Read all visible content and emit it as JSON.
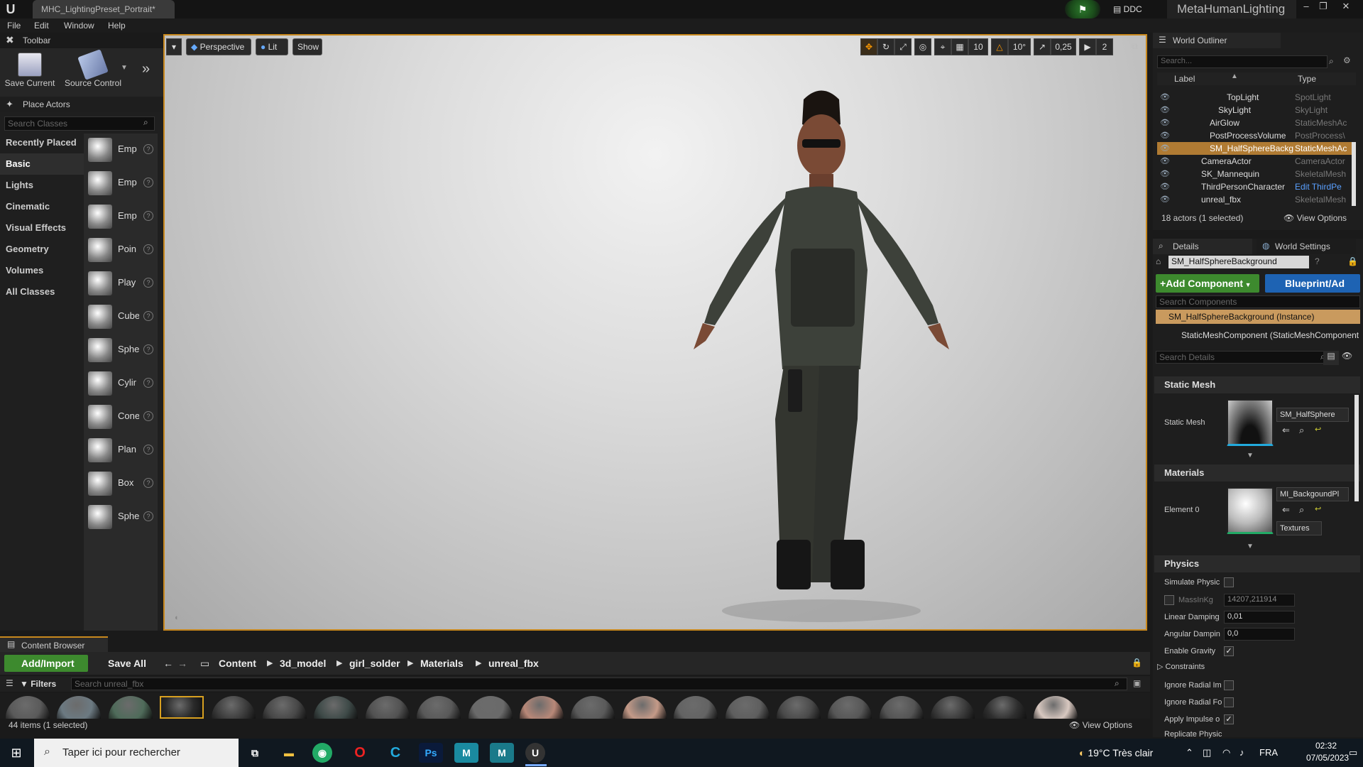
{
  "window": {
    "doc_tab": "MHC_LightingPreset_Portrait*",
    "ddc_label": "DDC",
    "project_name": "MetaHumanLighting",
    "controls": [
      "‒",
      "❐",
      "✕"
    ]
  },
  "menu": [
    "File",
    "Edit",
    "Window",
    "Help"
  ],
  "toolbar_panel": {
    "title": "Toolbar",
    "save_current": "Save Current",
    "source_control": "Source Control",
    "more": "»"
  },
  "place_actors": {
    "title": "Place Actors",
    "search_placeholder": "Search Classes",
    "categories": [
      "Recently Placed",
      "Basic",
      "Lights",
      "Cinematic",
      "Visual Effects",
      "Geometry",
      "Volumes",
      "All Classes"
    ],
    "active_category": "Basic",
    "actors": [
      "Emp",
      "Emp",
      "Emp",
      "Poin",
      "Play",
      "Cube",
      "Sphe",
      "Cylir",
      "Cone",
      "Plan",
      "Box",
      "Sphe"
    ]
  },
  "viewport": {
    "perspective": "Perspective",
    "lit": "Lit",
    "show": "Show",
    "grid_snap": "10",
    "rot_snap": "10°",
    "scale_snap": "0,25",
    "camera_speed": "2"
  },
  "outliner": {
    "title": "World Outliner",
    "search_placeholder": "Search...",
    "col_label": "Label",
    "col_type": "Type",
    "rows": [
      {
        "label": "TopLight",
        "type": "SpotLight",
        "indent": 3,
        "selected": false
      },
      {
        "label": "SkyLight",
        "type": "SkyLight",
        "indent": 2,
        "selected": false
      },
      {
        "label": "AirGlow",
        "type": "StaticMeshAc",
        "indent": 1,
        "selected": false
      },
      {
        "label": "PostProcessVolume",
        "type": "PostProcess\\",
        "indent": 1,
        "selected": false
      },
      {
        "label": "SM_HalfSphereBackg",
        "type": "StaticMeshAc",
        "indent": 1,
        "selected": true
      },
      {
        "label": "CameraActor",
        "type": "CameraActor",
        "indent": 0,
        "selected": false
      },
      {
        "label": "SK_Mannequin",
        "type": "SkeletalMesh",
        "indent": 0,
        "selected": false
      },
      {
        "label": "ThirdPersonCharacter",
        "type": "Edit ThirdPe",
        "indent": 0,
        "selected": false
      },
      {
        "label": "unreal_fbx",
        "type": "SkeletalMesh",
        "indent": 0,
        "selected": false
      }
    ],
    "status": "18 actors (1 selected)",
    "view_options": "View Options"
  },
  "details": {
    "title": "Details",
    "world_settings": "World Settings",
    "actor_name": "SM_HalfSphereBackground",
    "add_component": "Add Component",
    "blueprint": "Blueprint/Ad",
    "search_components_placeholder": "Search Components",
    "component_instance": "SM_HalfSphereBackground (Instance)",
    "component_static": "StaticMeshComponent (StaticMeshComponent",
    "search_details_placeholder": "Search Details",
    "static_mesh_section": "Static Mesh",
    "static_mesh_label": "Static Mesh",
    "static_mesh_asset": "SM_HalfSphere",
    "materials_section": "Materials",
    "element0_label": "Element 0",
    "material_asset": "MI_BackgoundPl",
    "textures": "Textures",
    "physics_section": "Physics",
    "simulate_physics": "Simulate Physic",
    "mass_kg": "MassInKg",
    "mass_value": "14207,211914",
    "linear_damping": "Linear Damping",
    "linear_damping_value": "0,01",
    "angular_damping": "Angular Dampin",
    "angular_damping_value": "0,0",
    "enable_gravity": "Enable Gravity",
    "constraints": "Constraints",
    "ignore_radial_impulse": "Ignore Radial Im",
    "ignore_radial_force": "Ignore Radial Fo",
    "apply_impulse": "Apply Impulse o",
    "replicate_physics": "Replicate Physic"
  },
  "content_browser": {
    "title": "Content Browser",
    "add_import": "Add/Import",
    "save_all": "Save All",
    "path": [
      "Content",
      "3d_model",
      "girl_solder",
      "Materials",
      "unreal_fbx"
    ],
    "filters": "Filters",
    "search_placeholder": "Search unreal_fbx",
    "status": "44 items (1 selected)",
    "view_options": "View Options",
    "asset_colors": [
      "#5a5a5a",
      "#6c7a82",
      "#4f6b5a",
      "#2a2a2a",
      "#3b3b3b",
      "#474747",
      "#3e4a48",
      "#525252",
      "#595959",
      "#6a6a6a",
      "#b88878",
      "#5a5a5a",
      "#c49a88",
      "#636363",
      "#5e5e5e",
      "#4a4a4a",
      "#575757",
      "#545454",
      "#3a3a3a",
      "#2e2e2e",
      "#d8c8c0"
    ]
  },
  "taskbar": {
    "search_text": "Taper ici pour rechercher",
    "weather": "19°C  Très clair",
    "lang": "FRA",
    "time": "02:32",
    "date": "07/05/2023"
  }
}
